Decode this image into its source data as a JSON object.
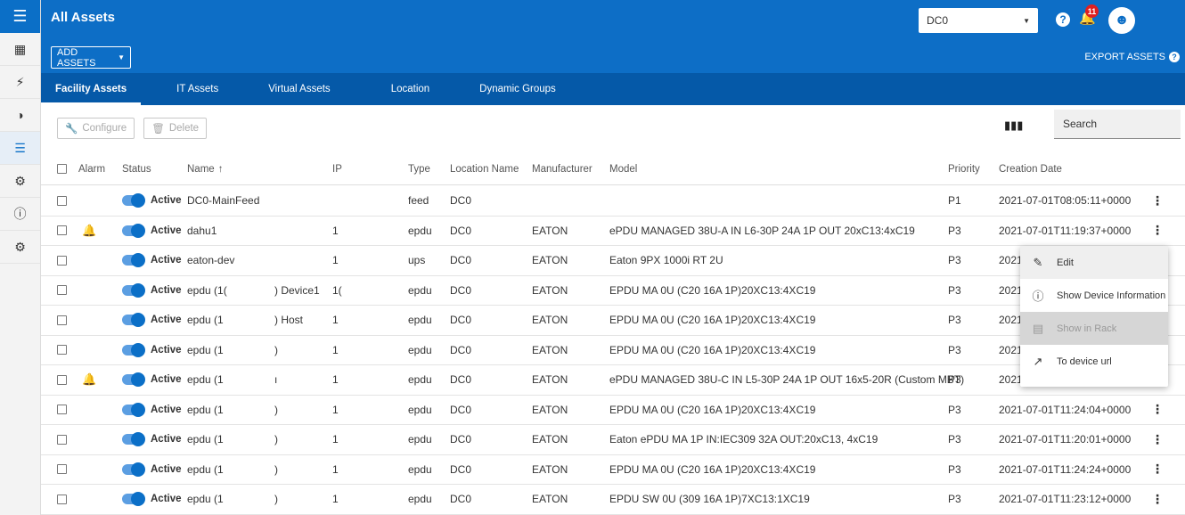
{
  "rail": {
    "items": [
      "dashboard",
      "power",
      "contrast",
      "assets",
      "settings-group",
      "info",
      "settings"
    ]
  },
  "header": {
    "title": "All Assets",
    "add_assets": "ADD ASSETS",
    "export_assets": "EXPORT ASSETS",
    "dc_select": "DC0",
    "notif_count": "11"
  },
  "tabs": [
    {
      "label": "Facility Assets",
      "active": true
    },
    {
      "label": "IT Assets"
    },
    {
      "label": "Virtual Assets"
    },
    {
      "label": "Location"
    },
    {
      "label": "Dynamic Groups"
    }
  ],
  "toolbar": {
    "configure": "Configure",
    "delete": "Delete",
    "search_label": "Search"
  },
  "table": {
    "headers": {
      "alarm": "Alarm",
      "status": "Status",
      "name": "Name",
      "ip": "IP",
      "type": "Type",
      "location": "Location Name",
      "manufacturer": "Manufacturer",
      "model": "Model",
      "priority": "Priority",
      "created": "Creation Date"
    },
    "active_label": "Active",
    "rows": [
      {
        "alarm": false,
        "name": "DC0-MainFeed",
        "ip": "",
        "type": "feed",
        "location": "DC0",
        "manufacturer": "",
        "model": "",
        "priority": "P1",
        "created": "2021-07-01T08:05:11+0000",
        "kebab": true
      },
      {
        "alarm": true,
        "name": "dahu1",
        "ip": "1",
        "type": "epdu",
        "location": "DC0",
        "manufacturer": "EATON",
        "model": "ePDU MANAGED 38U-A IN L6-30P 24A 1P OUT 20xC13:4xC19",
        "priority": "P3",
        "created": "2021-07-01T11:19:37+0000",
        "kebab": true
      },
      {
        "alarm": false,
        "name": "eaton-dev",
        "ip": "1",
        "type": "ups",
        "location": "DC0",
        "manufacturer": "EATON",
        "model": "Eaton 9PX 1000i RT 2U",
        "priority": "P3",
        "created": "2021",
        "kebab": false
      },
      {
        "alarm": false,
        "name": "epdu (1(",
        "name2": ") Device1",
        "ip": "1(",
        "type": "epdu",
        "location": "DC0",
        "manufacturer": "EATON",
        "model": "EPDU MA 0U (C20 16A 1P)20XC13:4XC19",
        "priority": "P3",
        "created": "2021",
        "kebab": false
      },
      {
        "alarm": false,
        "name": "epdu (1",
        "name2": ") Host",
        "ip": "1",
        "type": "epdu",
        "location": "DC0",
        "manufacturer": "EATON",
        "model": "EPDU MA 0U (C20 16A 1P)20XC13:4XC19",
        "priority": "P3",
        "created": "2021",
        "kebab": false
      },
      {
        "alarm": false,
        "name": "epdu (1",
        "name2": ")",
        "ip": "1",
        "type": "epdu",
        "location": "DC0",
        "manufacturer": "EATON",
        "model": "EPDU MA 0U (C20 16A 1P)20XC13:4XC19",
        "priority": "P3",
        "created": "2021",
        "kebab": false
      },
      {
        "alarm": true,
        "name": "epdu (1",
        "name2": "ı",
        "ip": "1",
        "type": "epdu",
        "location": "DC0",
        "manufacturer": "EATON",
        "model": "ePDU MANAGED 38U-C IN L5-30P 24A 1P OUT 16x5-20R (Custom MBT)",
        "priority": "P3",
        "created": "2021",
        "kebab": false
      },
      {
        "alarm": false,
        "name": "epdu (1",
        "name2": ")",
        "ip": "1",
        "type": "epdu",
        "location": "DC0",
        "manufacturer": "EATON",
        "model": "EPDU MA 0U (C20 16A 1P)20XC13:4XC19",
        "priority": "P3",
        "created": "2021-07-01T11:24:04+0000",
        "kebab": true
      },
      {
        "alarm": false,
        "name": "epdu (1",
        "name2": ")",
        "ip": "1",
        "type": "epdu",
        "location": "DC0",
        "manufacturer": "EATON",
        "model": "Eaton ePDU MA 1P IN:IEC309 32A OUT:20xC13, 4xC19",
        "priority": "P3",
        "created": "2021-07-01T11:20:01+0000",
        "kebab": true
      },
      {
        "alarm": false,
        "name": "epdu (1",
        "name2": ")",
        "ip": "1",
        "type": "epdu",
        "location": "DC0",
        "manufacturer": "EATON",
        "model": "EPDU MA 0U (C20 16A 1P)20XC13:4XC19",
        "priority": "P3",
        "created": "2021-07-01T11:24:24+0000",
        "kebab": true
      },
      {
        "alarm": false,
        "name": "epdu (1",
        "name2": ")",
        "ip": "1",
        "type": "epdu",
        "location": "DC0",
        "manufacturer": "EATON",
        "model": "EPDU SW 0U (309 16A 1P)7XC13:1XC19",
        "priority": "P3",
        "created": "2021-07-01T11:23:12+0000",
        "kebab": true
      }
    ]
  },
  "menu": {
    "items": [
      {
        "label": "Edit",
        "icon": "pencil-icon",
        "state": "hover"
      },
      {
        "label": "Show Device Information",
        "icon": "info-icon",
        "state": "normal"
      },
      {
        "label": "Show in Rack",
        "icon": "rack-icon",
        "state": "disabled"
      },
      {
        "label": "To device url",
        "icon": "external-link-icon",
        "state": "normal"
      }
    ]
  },
  "colors": {
    "primary": "#0d6ec6",
    "tabs": "#0559a8",
    "alarm": "#cc2020",
    "toggle": "#0b6fc7"
  }
}
